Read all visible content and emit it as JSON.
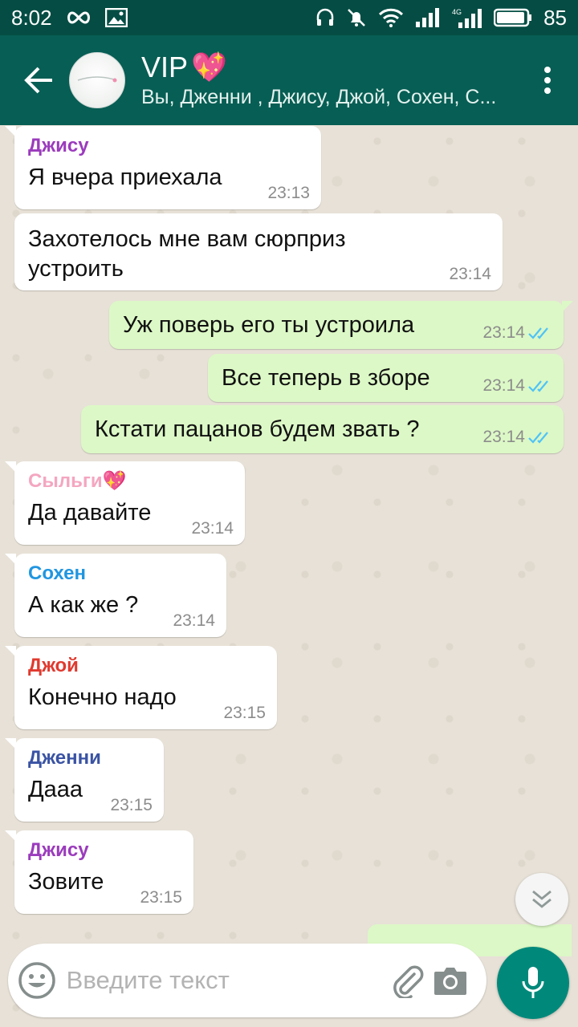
{
  "status_bar": {
    "time": "8:02",
    "battery": "85",
    "network": "4G"
  },
  "header": {
    "title": "VIP",
    "title_emoji": "💖",
    "members": "Вы, Дженни , Джису, Джой, Сохен, С..."
  },
  "messages": [
    {
      "direction": "in",
      "sender": "Джису",
      "sender_color": "#9b3bbd",
      "text": "Я вчера приехала",
      "time": "23:13"
    },
    {
      "direction": "in",
      "sender": "",
      "text": "Захотелось мне вам сюрприз устроить",
      "time": "23:14"
    },
    {
      "direction": "out",
      "text": "Уж поверь его ты устроила",
      "time": "23:14",
      "status": "read"
    },
    {
      "direction": "out",
      "text": "Все теперь в зборе",
      "time": "23:14",
      "status": "read"
    },
    {
      "direction": "out",
      "text": "Кстати пацанов будем звать ?",
      "time": "23:14",
      "status": "read"
    },
    {
      "direction": "in",
      "sender": "Сыльги",
      "sender_emoji": "💖",
      "sender_color": "#f4a6c0",
      "text": "Да давайте",
      "time": "23:14"
    },
    {
      "direction": "in",
      "sender": "Сохен",
      "sender_color": "#2196e0",
      "text": "А как же ?",
      "time": "23:14"
    },
    {
      "direction": "in",
      "sender": "Джой",
      "sender_color": "#e03a2f",
      "text": "Конечно надо",
      "time": "23:15"
    },
    {
      "direction": "in",
      "sender": "Дженни",
      "sender_color": "#3a53a4",
      "text": "Дааа",
      "time": "23:15"
    },
    {
      "direction": "in",
      "sender": "Джису",
      "sender_color": "#9b3bbd",
      "text": "Зовите",
      "time": "23:15"
    }
  ],
  "input": {
    "placeholder": "Введите текст",
    "value": ""
  },
  "colors": {
    "header": "#075e54",
    "status_bar": "#054d44",
    "outgoing_bubble": "#dcf8c6",
    "incoming_bubble": "#ffffff",
    "read_ticks": "#4fc3f7",
    "mic_button": "#00897b"
  },
  "icons": {
    "back": "arrow-left-icon",
    "menu": "more-vertical-icon",
    "emoji": "smiley-icon",
    "attach": "paperclip-icon",
    "camera": "camera-icon",
    "mic": "microphone-icon",
    "scroll": "double-chevron-down-icon"
  }
}
